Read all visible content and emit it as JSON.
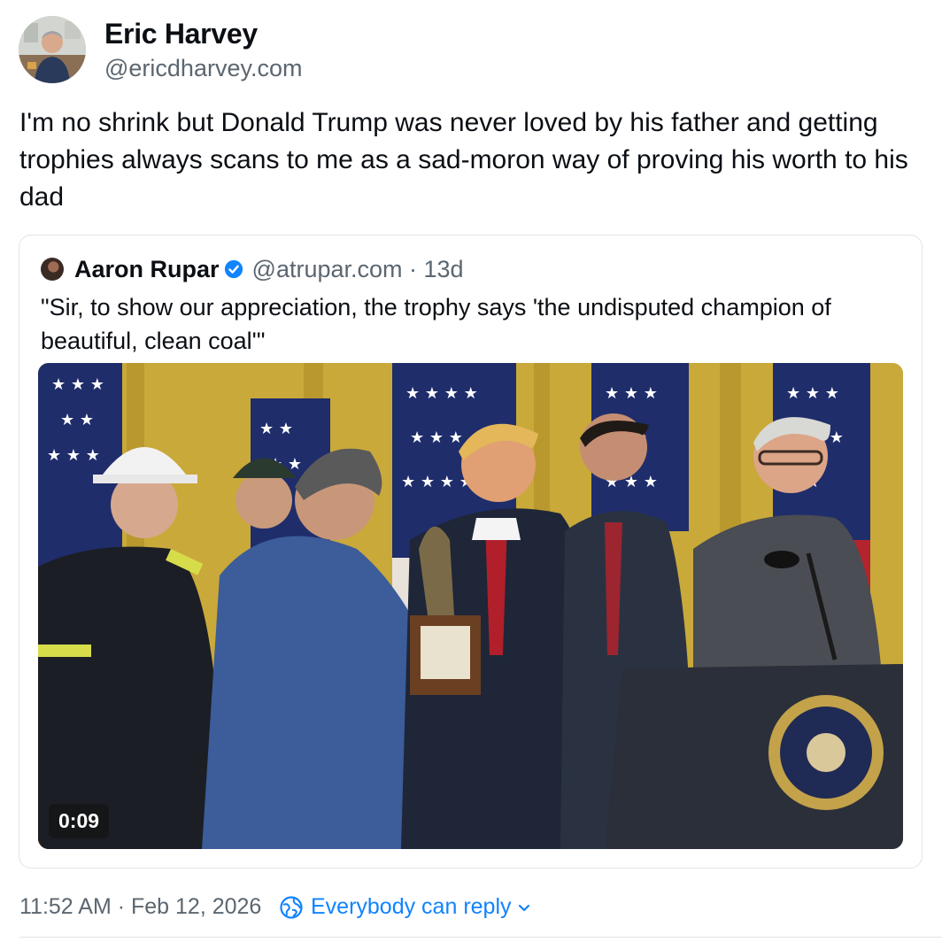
{
  "author": {
    "display_name": "Eric Harvey",
    "handle": "@ericdharvey.com",
    "avatar_icon": "profile-photo"
  },
  "post": {
    "text": "I'm no shrink but Donald Trump was never loved by his father and getting trophies always scans to me as a sad-moron way of proving his worth to his dad"
  },
  "quote": {
    "display_name": "Aaron Rupar",
    "verified_icon": "verified-check-icon",
    "handle_time": "@atrupar.com · 13d",
    "text": "\"Sir, to show our appreciation, the trophy says 'the undisputed champion of beautiful, clean coal'\"",
    "video": {
      "duration": "0:09"
    }
  },
  "footer": {
    "timestamp": "11:52 AM · Feb 12, 2026",
    "reply_setting": "Everybody can reply",
    "accent_color": "#1083fe"
  }
}
